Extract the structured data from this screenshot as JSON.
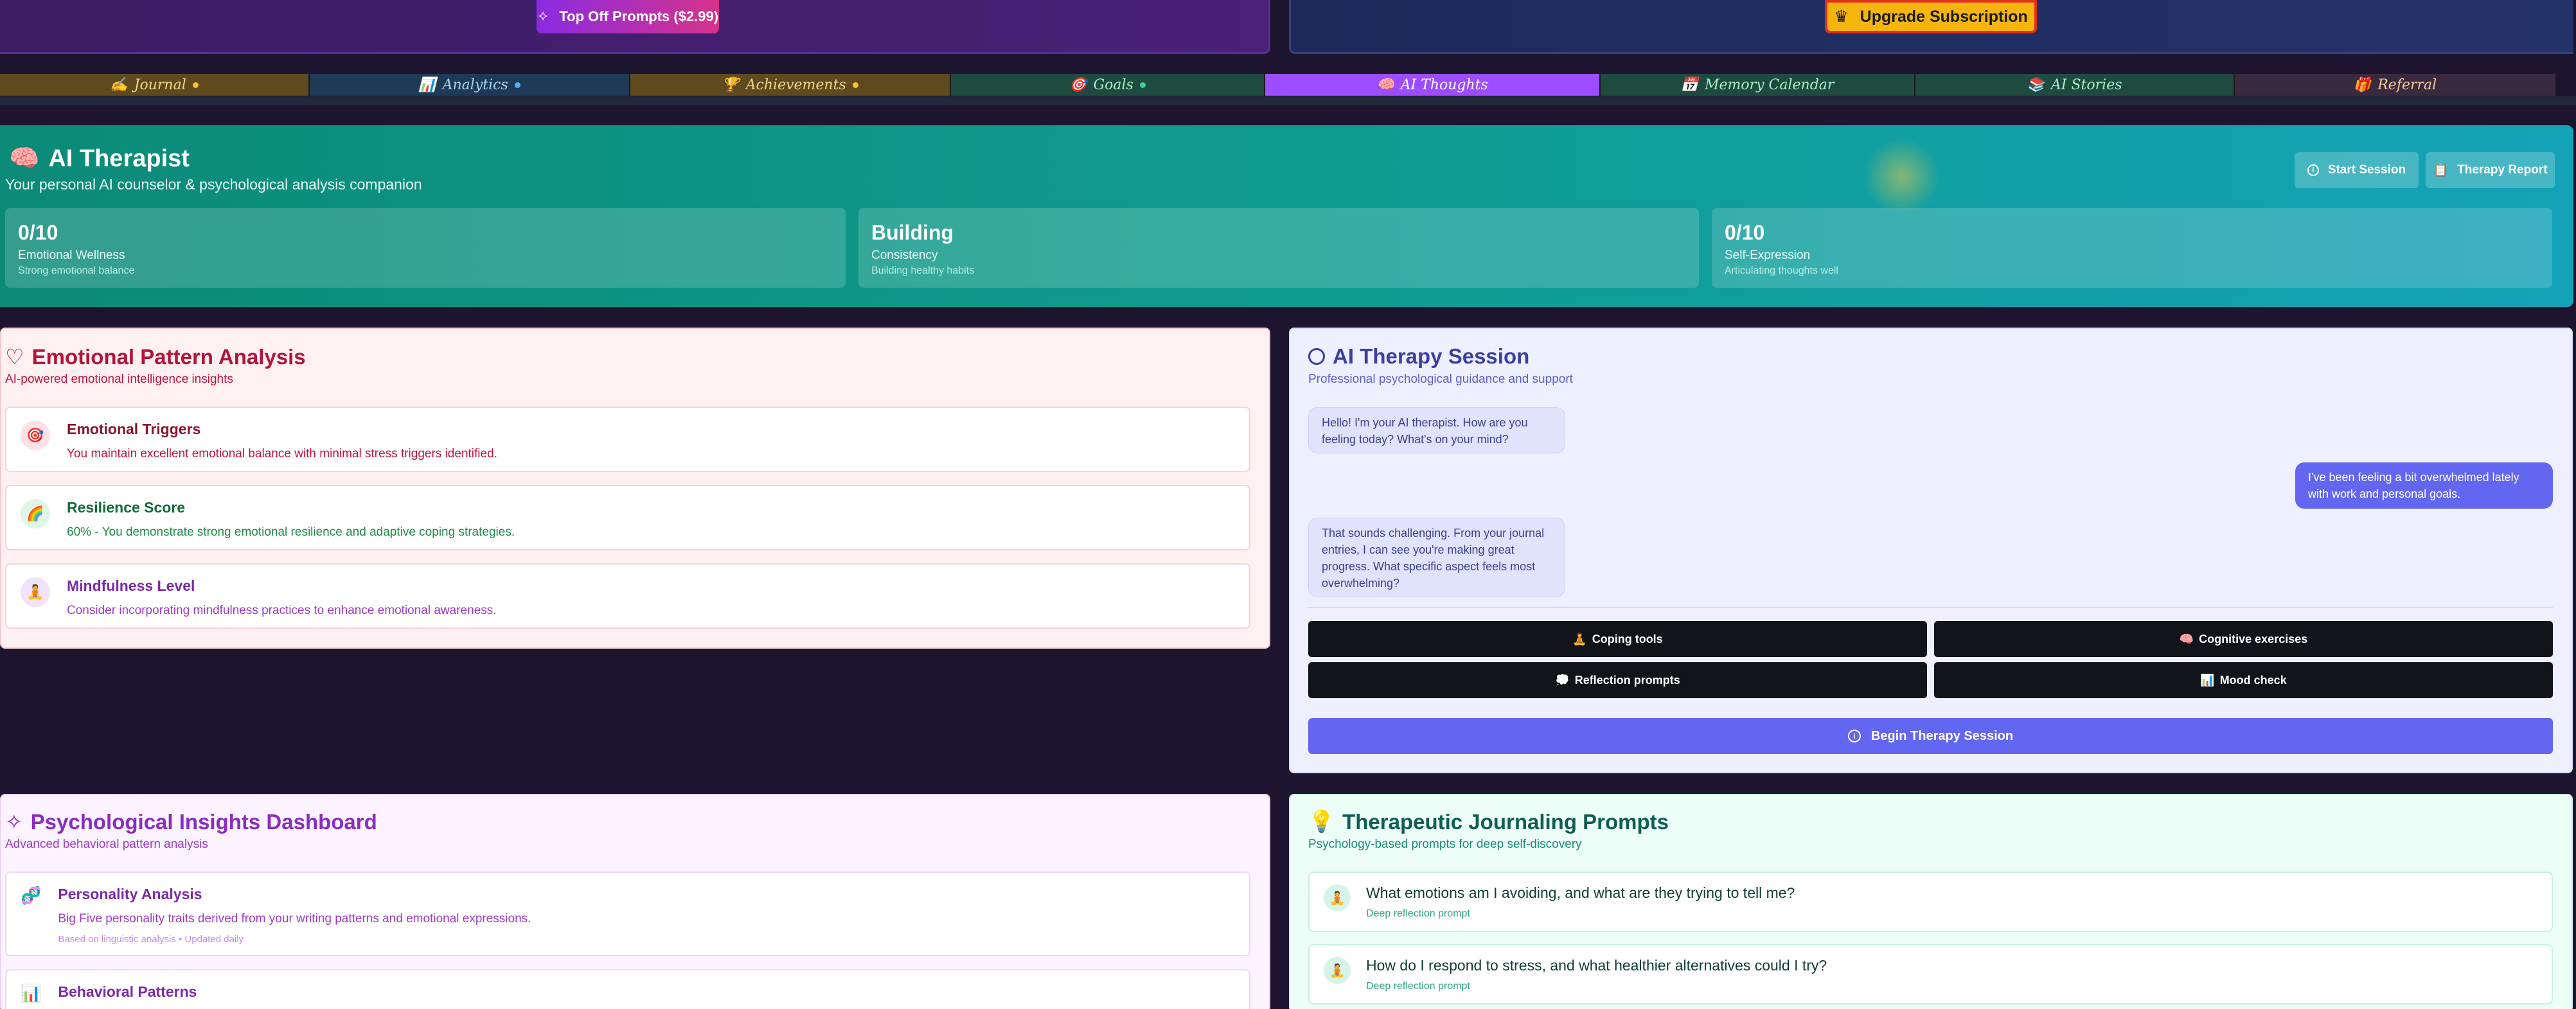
{
  "top": {
    "topoff_label": "Top Off Prompts ($2.99)",
    "upgrade_label": "Upgrade Subscription"
  },
  "tabs": [
    {
      "label": "Journal",
      "icon": "✍",
      "bg": "#5e4a1e",
      "dot": "#f2c230"
    },
    {
      "label": "Analytics",
      "icon": "📊",
      "bg": "#1f3a56",
      "dot": "#4fb4f5"
    },
    {
      "label": "Achievements",
      "icon": "🏆",
      "bg": "#5e4a1e",
      "dot": "#f2c230"
    },
    {
      "label": "Goals",
      "icon": "🎯",
      "bg": "#1e4a40",
      "dot": "#3fd08a"
    },
    {
      "label": "AI Thoughts",
      "icon": "🧠",
      "bg": "#9b4dff",
      "dot": ""
    },
    {
      "label": "Memory Calendar",
      "icon": "📅",
      "bg": "#1e4a40",
      "dot": ""
    },
    {
      "label": "AI Stories",
      "icon": "📚",
      "bg": "#1e4a40",
      "dot": ""
    },
    {
      "label": "Referral",
      "icon": "🎁",
      "bg": "#3a2a40",
      "dot": ""
    }
  ],
  "hero": {
    "title": "AI Therapist",
    "subtitle": "Your personal AI counselor & psychological analysis companion",
    "start_session": "Start Session",
    "therapy_report": "Therapy Report",
    "stats": [
      {
        "value": "0/10",
        "label": "Emotional Wellness",
        "desc": "Strong emotional balance"
      },
      {
        "value": "Building",
        "label": "Consistency",
        "desc": "Building healthy habits"
      },
      {
        "value": "0/10",
        "label": "Self-Expression",
        "desc": "Articulating thoughts well"
      }
    ]
  },
  "emotional": {
    "title": "Emotional Pattern Analysis",
    "subtitle": "AI-powered emotional intelligence insights",
    "cards": [
      {
        "title": "Emotional Triggers",
        "text": "You maintain excellent emotional balance with minimal stress triggers identified.",
        "icon": "🎯",
        "color": "#c0143c",
        "title_color": "#8a1230",
        "ic_bg": "#fde1e6"
      },
      {
        "title": "Resilience Score",
        "text": "60% - You demonstrate strong emotional resilience and adaptive coping strategies.",
        "icon": "🌈",
        "color": "#1e8a48",
        "title_color": "#126b38",
        "ic_bg": "#def6e6"
      },
      {
        "title": "Mindfulness Level",
        "text": "Consider incorporating mindfulness practices to enhance emotional awareness.",
        "icon": "🧘",
        "color": "#9b3ac8",
        "title_color": "#7a2aa8",
        "ic_bg": "#f2e2fb"
      }
    ]
  },
  "session": {
    "title": "AI Therapy Session",
    "subtitle": "Professional psychological guidance and support",
    "messages": [
      {
        "from": "ai",
        "text": "Hello! I'm your AI therapist. How are you feeling today? What's on your mind?"
      },
      {
        "from": "user",
        "text": "I've been feeling a bit overwhelmed lately with work and personal goals."
      },
      {
        "from": "ai",
        "text": "That sounds challenging. From your journal entries, I can see you're making great progress. What specific aspect feels most overwhelming?"
      }
    ],
    "quick": [
      {
        "icon": "🧘",
        "label": "Coping tools"
      },
      {
        "icon": "🧠",
        "label": "Cognitive exercises"
      },
      {
        "icon": "💭",
        "label": "Reflection prompts"
      },
      {
        "icon": "📊",
        "label": "Mood check"
      }
    ],
    "begin_label": "Begin Therapy Session"
  },
  "psych": {
    "title": "Psychological Insights Dashboard",
    "subtitle": "Advanced behavioral pattern analysis",
    "cards": [
      {
        "title": "Personality Analysis",
        "text": "Big Five personality traits derived from your writing patterns and emotional expressions.",
        "meta": "Based on linguistic analysis • Updated daily",
        "icon": "🧬"
      },
      {
        "title": "Behavioral Patterns",
        "text": "",
        "meta": "",
        "icon": "📊"
      }
    ]
  },
  "prompts": {
    "title": "Therapeutic Journaling Prompts",
    "subtitle": "Psychology-based prompts for deep self-discovery",
    "items": [
      {
        "text": "What emotions am I avoiding, and what are they trying to tell me?",
        "meta": "Deep reflection prompt",
        "icon": "🧘"
      },
      {
        "text": "How do I respond to stress, and what healthier alternatives could I try?",
        "meta": "Deep reflection prompt",
        "icon": "🧘"
      }
    ]
  }
}
